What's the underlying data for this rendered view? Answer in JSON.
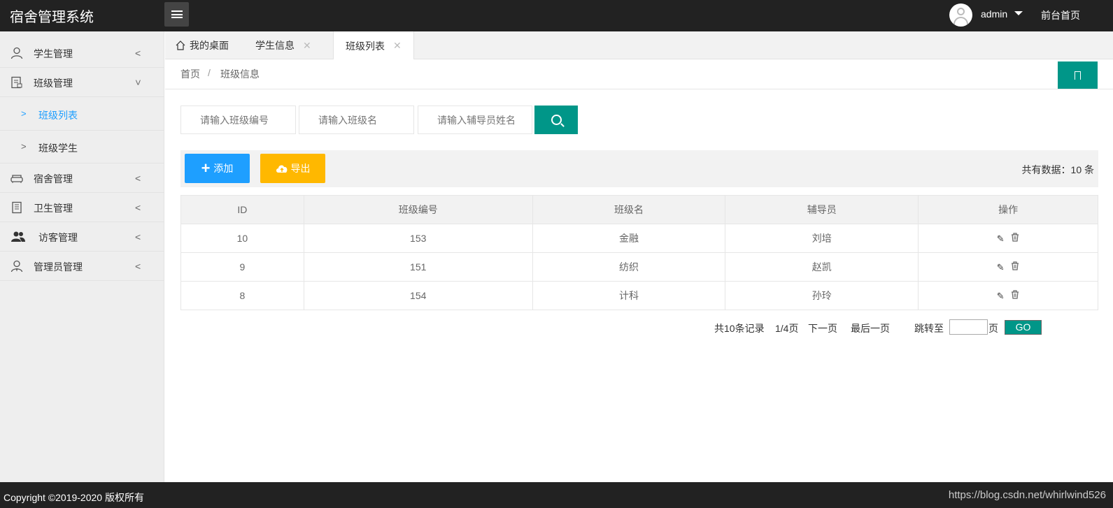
{
  "header": {
    "logo": "宿舍管理系统",
    "user": "admin",
    "front_home": "前台首页"
  },
  "sidebar": {
    "items": [
      {
        "label": "学生管理",
        "icon": "user-icon"
      },
      {
        "label": "班级管理",
        "icon": "class-icon"
      },
      {
        "label": "宿舍管理",
        "icon": "sofa-icon"
      },
      {
        "label": "卫生管理",
        "icon": "notebook-icon"
      },
      {
        "label": "访客管理",
        "icon": "visitors-icon"
      },
      {
        "label": "管理员管理",
        "icon": "admin-icon"
      }
    ],
    "sub_items": [
      {
        "label": "班级列表",
        "active": true
      },
      {
        "label": "班级学生",
        "active": false
      }
    ]
  },
  "tabs": [
    {
      "label": "我的桌面"
    },
    {
      "label": "学生信息"
    },
    {
      "label": "班级列表"
    }
  ],
  "breadcrumb": {
    "home": "首页",
    "separator": "/",
    "current": "班级信息"
  },
  "search": {
    "class_no_placeholder": "请输入班级编号",
    "class_name_placeholder": "请输入班级名",
    "counselor_placeholder": "请输入辅导员姓名"
  },
  "toolbar": {
    "add_label": "添加",
    "export_label": "导出",
    "total": "共有数据：10 条"
  },
  "table": {
    "columns": [
      "ID",
      "班级编号",
      "班级名",
      "辅导员",
      "操作"
    ],
    "rows": [
      {
        "id": "10",
        "class_no": "153",
        "class_name": "金融",
        "counselor": "刘培"
      },
      {
        "id": "9",
        "class_no": "151",
        "class_name": "纺织",
        "counselor": "赵凯"
      },
      {
        "id": "8",
        "class_no": "154",
        "class_name": "计科",
        "counselor": "孙玲"
      }
    ]
  },
  "pagination": {
    "records": "共10条记录",
    "page": "1/4页",
    "next": "下一页",
    "last": "最后一页",
    "jump_to": "跳转至",
    "page_unit": "页",
    "go": "GO"
  },
  "footer": {
    "copyright": "Copyright ©2019-2020 版权所有",
    "watermark": "https://blog.csdn.net/whirlwind526"
  },
  "colors": {
    "header_bg": "#222222",
    "accent_teal": "#009688",
    "accent_blue": "#1e9fff",
    "accent_yellow": "#ffb800"
  }
}
